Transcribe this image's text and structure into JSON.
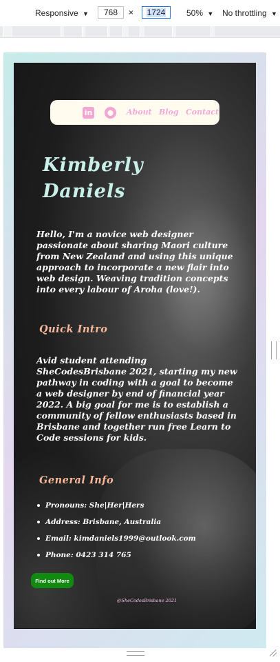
{
  "devtools": {
    "device": "Responsive",
    "width": "768",
    "times": "×",
    "height": "1724",
    "zoom": "50%",
    "throttling": "No throttling",
    "dropdown": "▼"
  },
  "site": {
    "nav": {
      "linkedin_icon": "in",
      "github_icon": "⬤",
      "links": [
        "About",
        "Blog",
        "Contact"
      ]
    },
    "title_line1": "Kimberly",
    "title_line2": "Daniels",
    "intro": "Hello, I'm a novice web designer passionate about sharing Maori culture from New Zealand and using this unique approach to incorporate a new flair into web design. Weaving tradition concepts into every labour of Aroha (love!).",
    "quick_intro_heading": "Quick Intro",
    "quick_intro_text": "Avid student attending SheCodesBrisbane 2021, starting my new pathway in coding with a goal to become a web designer by end of financial year 2022. A big goal for me is to establish a community of fellow enthusiasts based in Brisbane and together run free Learn to Code sessions for kids.",
    "general_info_heading": "General Info",
    "info_items": [
      "Pronouns: She|Her|Hers",
      "Address: Brisbane, Australia",
      "Email: kimdaniels1999@outlook.com",
      "Phone: 0423 314 765"
    ],
    "button_label": "Find out More",
    "footer": "@SheCodesBrisbane 2021"
  },
  "colors": {
    "nav_bg": "#fffbee",
    "nav_link": "#f4a9d8",
    "title": "#c9efe9",
    "heading": "#f6b79a",
    "button": "#128a12"
  }
}
